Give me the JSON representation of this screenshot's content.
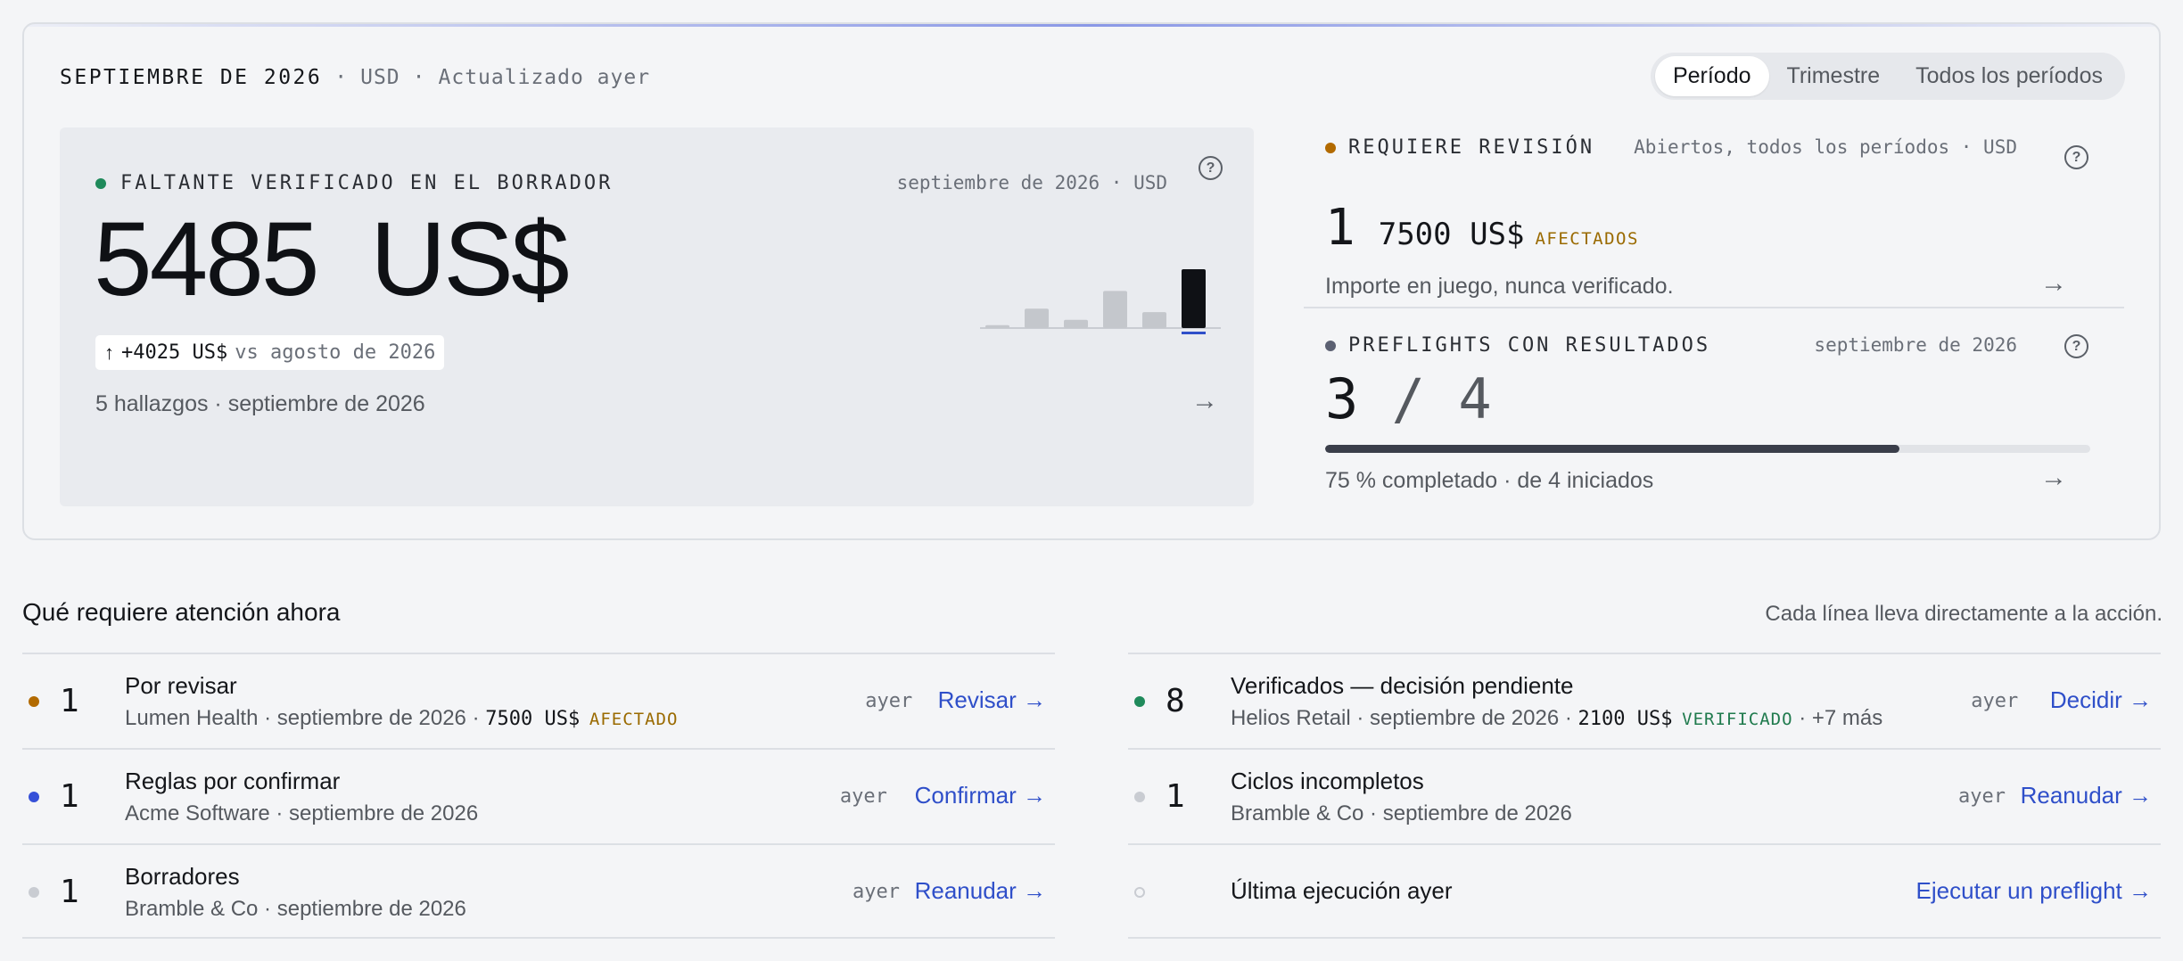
{
  "overview": {
    "month": "SEPTIEMBRE DE 2026",
    "currency": "USD",
    "updated": "Actualizado ayer",
    "sep": "·",
    "segments": [
      "Período",
      "Trimestre",
      "Todos los períodos"
    ],
    "active_segment": 0
  },
  "main_metric": {
    "label": "FALTANTE VERIFICADO EN EL BORRADOR",
    "meta": "septiembre de 2026 · USD",
    "value": "5485",
    "unit": "US$",
    "delta_arrow": "↑",
    "delta": "+4025 US$",
    "delta_vs": "vs agosto de 2026",
    "footer": "5 hallazgos · septiembre de 2026",
    "status_color": "#1f8a5b"
  },
  "sparkline": {
    "values": [
      0.05,
      0.33,
      0.14,
      0.63,
      0.27,
      1.0
    ],
    "highlight_index": 5
  },
  "review": {
    "label": "REQUIERE REVISIÓN",
    "meta": "Abiertos, todos los períodos · USD",
    "count": "1",
    "amount": "7500 US$",
    "tag": "AFECTADOS",
    "desc": "Importe en juego, nunca verificado.",
    "status_color": "#b26a00"
  },
  "preflights": {
    "label": "PREFLIGHTS CON RESULTADOS",
    "meta": "septiembre de 2026",
    "done": "3",
    "slash": "/",
    "total": "4",
    "progress": 0.75,
    "desc": "75 % completado · de 4 iniciados",
    "status_color": "#5b6072"
  },
  "attention": {
    "title": "Qué requiere atención ahora",
    "subtitle": "Cada línea lleva directamente a la acción.",
    "left": [
      {
        "dot": "#b26a00",
        "count": "1",
        "title": "Por revisar",
        "sub": "Lumen Health · septiembre de 2026 · ",
        "amount": "7500 US$",
        "tag": "AFECTADO",
        "tag_color": "#9a6a00",
        "extra": "",
        "when": "ayer",
        "action": "Revisar →"
      },
      {
        "dot": "#3650d8",
        "count": "1",
        "title": "Reglas por confirmar",
        "sub": "Acme Software · septiembre de 2026",
        "amount": "",
        "tag": "",
        "tag_color": "",
        "extra": "",
        "when": "ayer",
        "action": "Confirmar →"
      },
      {
        "dot": "#c9ccd2",
        "count": "1",
        "title": "Borradores",
        "sub": "Bramble & Co · septiembre de 2026",
        "amount": "",
        "tag": "",
        "tag_color": "",
        "extra": "",
        "when": "ayer",
        "action": "Reanudar →"
      }
    ],
    "right": [
      {
        "dot": "#1f8a5b",
        "count": "8",
        "title": "Verificados — decisión pendiente",
        "sub": "Helios Retail · septiembre de 2026 · ",
        "amount": "2100 US$",
        "tag": "VERIFICADO",
        "tag_color": "#1f7a4d",
        "extra": " · +7 más",
        "when": "ayer",
        "action": "Decidir →"
      },
      {
        "dot": "#c9ccd2",
        "count": "1",
        "title": "Ciclos incompletos",
        "sub": "Bramble & Co · septiembre de 2026",
        "amount": "",
        "tag": "",
        "tag_color": "",
        "extra": "",
        "when": "ayer",
        "action": "Reanudar →"
      },
      {
        "dot": "ring",
        "count": "",
        "title": "Última ejecución ayer",
        "sub": "",
        "amount": "",
        "tag": "",
        "tag_color": "",
        "extra": "",
        "when": "",
        "action": "Ejecutar un preflight →"
      }
    ]
  },
  "icons": {
    "help": "?",
    "arrow": "→"
  }
}
